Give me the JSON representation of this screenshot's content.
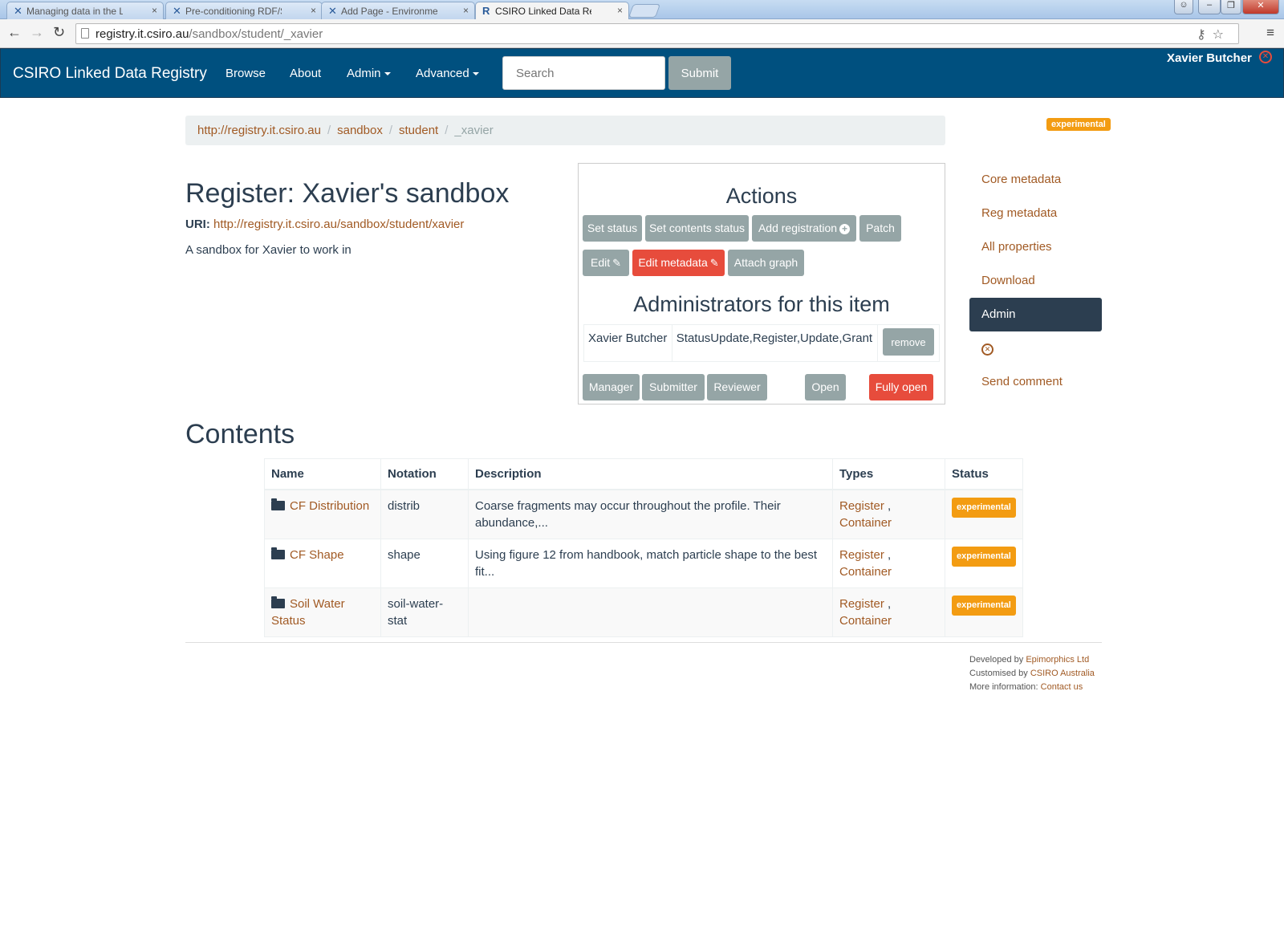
{
  "browser": {
    "tabs": [
      {
        "label": "Managing data in the LDR",
        "icon": "x"
      },
      {
        "label": "Pre-conditioning RDF/SKO",
        "icon": "x"
      },
      {
        "label": "Add Page - Environmental",
        "icon": "x"
      },
      {
        "label": "CSIRO Linked Data Registr",
        "icon": "R"
      }
    ],
    "url_host": "registry.it.csiro.au",
    "url_path": "/sandbox/student/_xavier"
  },
  "navbar": {
    "brand": "CSIRO Linked Data Registry",
    "links": [
      "Browse",
      "About",
      "Admin",
      "Advanced"
    ],
    "search_placeholder": "Search",
    "submit_label": "Submit",
    "user": "Xavier Butcher"
  },
  "breadcrumb": [
    "http://registry.it.csiro.au",
    "sandbox",
    "student",
    "_xavier"
  ],
  "status_badge": "experimental",
  "register": {
    "title": "Register: Xavier's sandbox",
    "uri_label": "URI:",
    "uri": "http://registry.it.csiro.au/sandbox/student/xavier",
    "description": "A sandbox for Xavier to work in"
  },
  "actions": {
    "heading": "Actions",
    "buttons": [
      "Set status",
      "Set contents status",
      "Add registration",
      "Patch",
      "Edit",
      "Edit metadata",
      "Attach graph"
    ],
    "admin_heading": "Administrators for this item",
    "admin": {
      "name": "Xavier Butcher",
      "permissions": "StatusUpdate,Register,Update,Grant",
      "remove_label": "remove"
    },
    "roles": [
      "Manager",
      "Submitter",
      "Reviewer",
      "Open",
      "Fully open"
    ]
  },
  "sidenav": {
    "items": [
      "Core metadata",
      "Reg metadata",
      "All properties",
      "Download",
      "Admin"
    ],
    "send_comment": "Send comment"
  },
  "contents": {
    "heading": "Contents",
    "columns": [
      "Name",
      "Notation",
      "Description",
      "Types",
      "Status"
    ],
    "rows": [
      {
        "name": "CF Distribution",
        "notation": "distrib",
        "description": "Coarse fragments may occur throughout the profile. Their abundance,...",
        "type1": "Register",
        "type2": "Container",
        "status": "experimental"
      },
      {
        "name": "CF Shape",
        "notation": "shape",
        "description": "Using figure 12 from handbook, match particle shape to the best fit...",
        "type1": "Register",
        "type2": "Container",
        "status": "experimental"
      },
      {
        "name": "Soil Water Status",
        "notation": "soil-water-stat",
        "description": "",
        "type1": "Register",
        "type2": "Container",
        "status": "experimental"
      }
    ]
  },
  "footer": {
    "developed_prefix": "Developed by ",
    "developed_link": "Epimorphics Ltd",
    "customised_prefix": "Customised by ",
    "customised_link": "CSIRO Australia",
    "more_prefix": "More information: ",
    "more_link": "Contact us"
  },
  "colors": {
    "navbar": "#00507f",
    "link": "#a15a24",
    "badge": "#f39c12",
    "danger": "#e74c3c",
    "grey_button": "#95a5a6"
  }
}
